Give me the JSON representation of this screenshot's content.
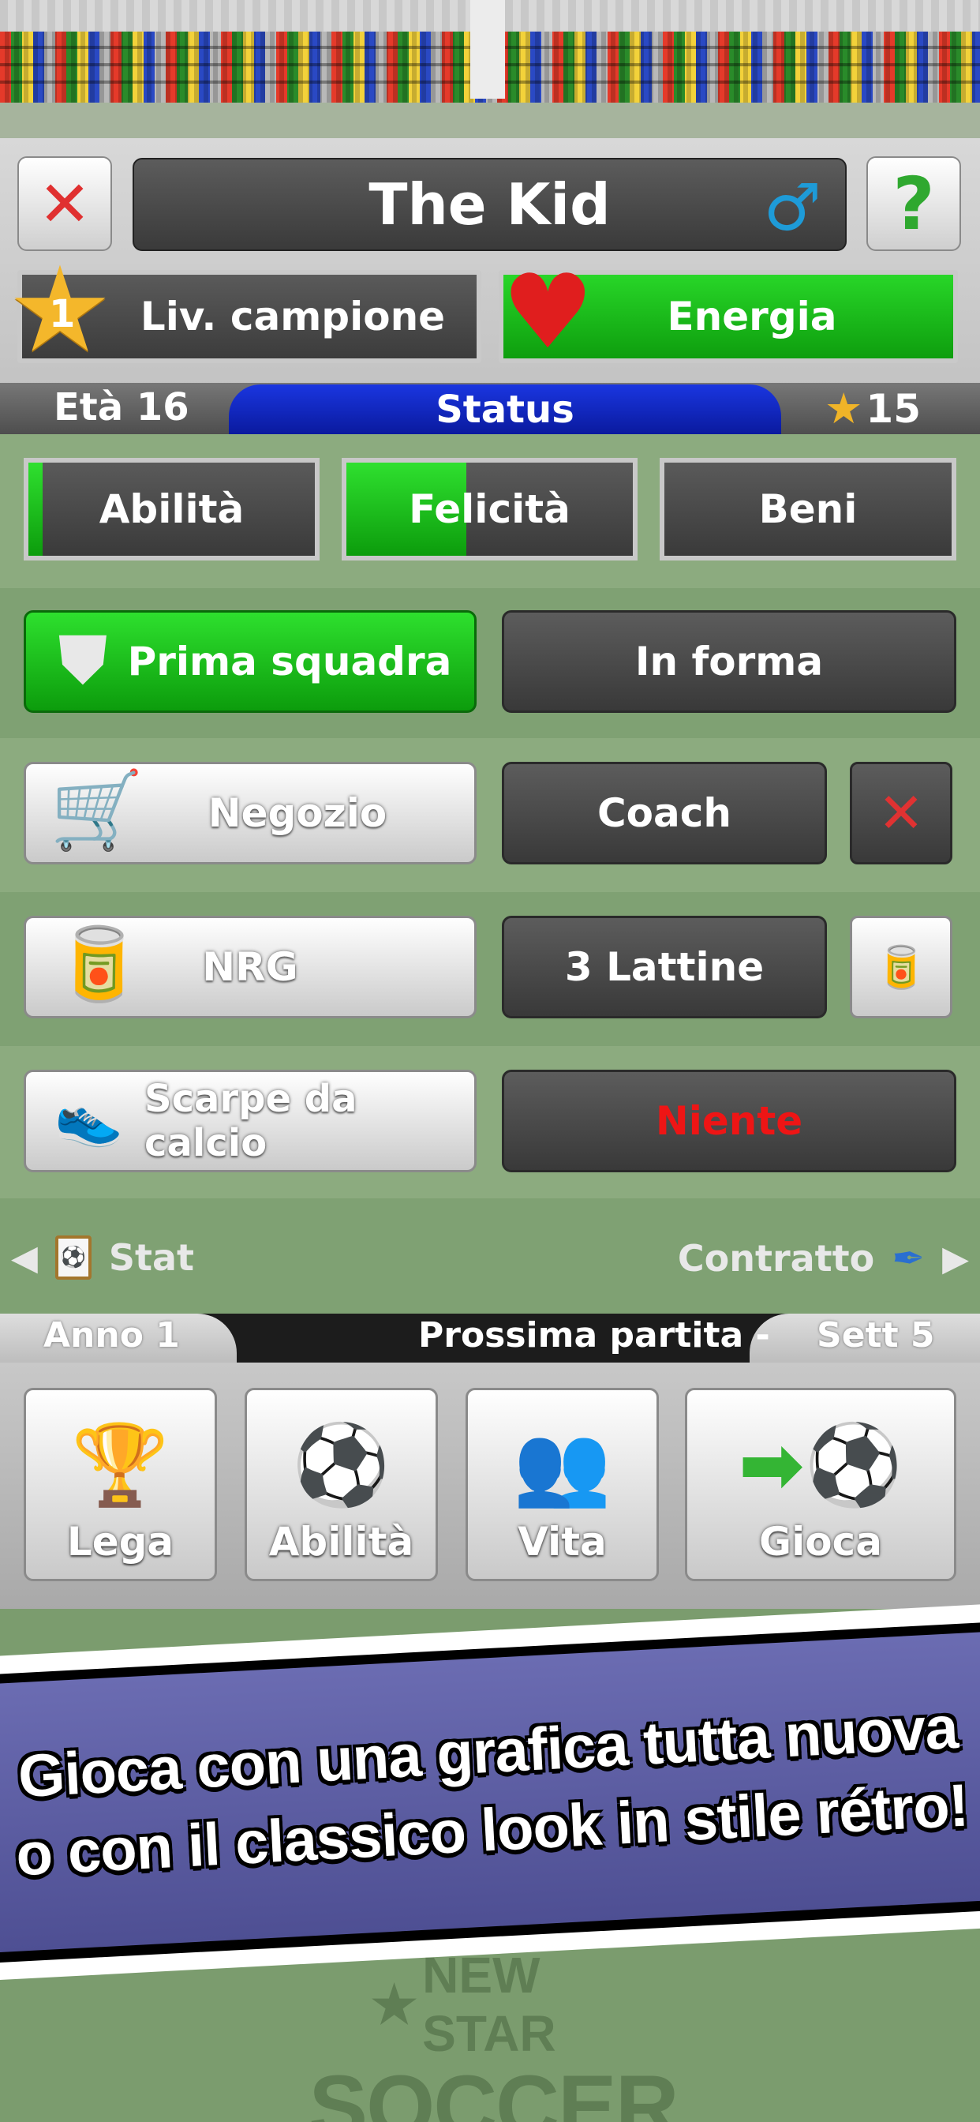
{
  "header": {
    "player_name": "The Kid",
    "close_icon": "x-icon",
    "help_label": "?",
    "gender_icon": "male-icon",
    "level_number": "1",
    "level_label": "Liv. campione",
    "energy_label": "Energia",
    "age_label": "Età 16",
    "status_label": "Status",
    "money_value": "15"
  },
  "tabs": [
    {
      "label": "Abilità",
      "fill": 0.05
    },
    {
      "label": "Felicità",
      "fill": 0.42
    },
    {
      "label": "Beni",
      "fill": 0
    }
  ],
  "rows": {
    "team_label": "Prima squadra",
    "form_label": "In forma",
    "shop_label": "Negozio",
    "coach_label": "Coach",
    "nrg_label": "NRG",
    "cans_label": "3 Lattine",
    "boots_label": "Scarpe da calcio",
    "boots_value": "Niente"
  },
  "nav": {
    "stat_label": "Stat",
    "contract_label": "Contratto"
  },
  "infobar": {
    "year_label": "Anno 1",
    "next_match_label": "Prossima partita -",
    "week_label": "Sett 5"
  },
  "menu": [
    {
      "label": "Lega",
      "icon": "trophy-icon"
    },
    {
      "label": "Abilità",
      "icon": "cone-ball-icon"
    },
    {
      "label": "Vita",
      "icon": "people-icon"
    },
    {
      "label": "Gioca",
      "icon": "arrow-ball-icon"
    }
  ],
  "promo": {
    "line1": "Gioca con una grafica tutta nuova",
    "line2": "o con il classico look in stile rétro!"
  },
  "logo": {
    "top": "NEW STAR",
    "bottom": "SOCCER"
  },
  "colors": {
    "accent_green": "#1cc41c",
    "status_blue": "#1a36e0",
    "field_green": "#8cab7f",
    "niente_red": "#ee1515"
  }
}
